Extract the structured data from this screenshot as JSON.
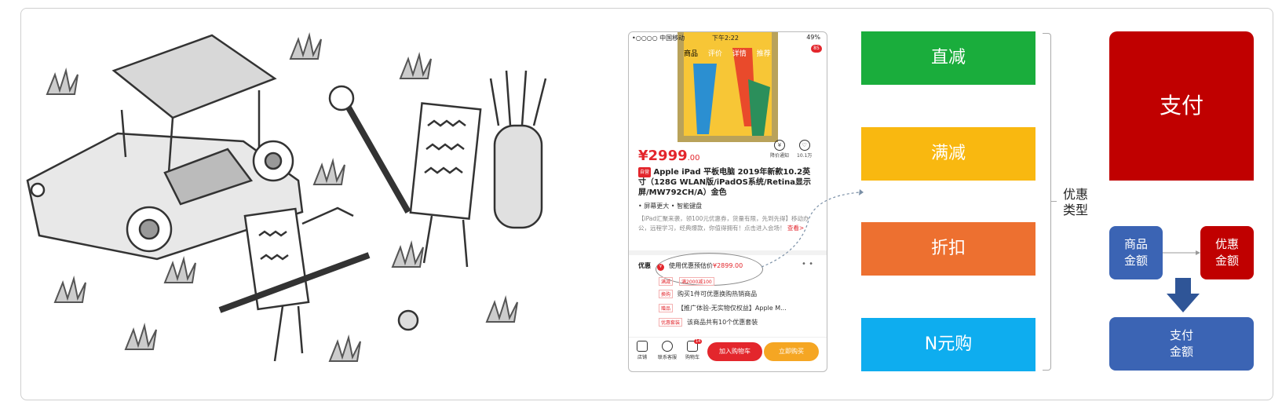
{
  "phone": {
    "status": {
      "carrier": "•○○○○ 中国移动",
      "time": "下午2:22",
      "battery": "49%"
    },
    "tabs": [
      "商品",
      "评价",
      "详情",
      "推荐"
    ],
    "cart_badge": "85",
    "price_main": "¥2999",
    "price_decimal": ".00",
    "notify_label": "降价通知",
    "fav_label": "10.1万",
    "title_tag": "自营",
    "title": "Apple iPad 平板电脑 2019年新款10.2英寸（128G WLAN版/iPadOS系统/Retina显示屏/MW792CH/A）金色",
    "features": "• 屏幕更大  • 智能键盘",
    "description": "【iPad汇聚来袭，领100元优惠券，货量有限，先到先得】移动办公，远程学习，经典爆款，你值得拥有！点击进入会场！",
    "more": "查看>",
    "promo_section_label": "优惠",
    "promo_main_text": "使用优惠预估价",
    "promo_main_price": "¥2899.00",
    "promo_rows": [
      {
        "label": "满减",
        "text": "",
        "extra": "满2000减100"
      },
      {
        "label": "换购",
        "text": "购买1件可优惠换购热销商品",
        "extra": ""
      },
      {
        "label": "赠品",
        "text": "【推广体验-无实物仅权益】Apple M...",
        "extra": ""
      },
      {
        "label": "优惠套装",
        "text": "该商品共有10个优惠套装",
        "extra": ""
      }
    ],
    "bottom_icons": [
      "店铺",
      "联系客服",
      "购物车"
    ],
    "cart_count": "14",
    "add_cart": "加入购物车",
    "buy_now": "立即购买"
  },
  "discount_types": {
    "items": [
      {
        "label": "直减",
        "color": "#1aad3c"
      },
      {
        "label": "满减",
        "color": "#f9b810"
      },
      {
        "label": "折扣",
        "color": "#ed7030"
      },
      {
        "label": "N元购",
        "color": "#0eadef"
      }
    ],
    "group_label": "优惠\n类型"
  },
  "payment": {
    "pay": "支付",
    "goods_amount": "商品\n金额",
    "discount_amount": "优惠\n金额",
    "pay_amount": "支付\n金额"
  }
}
